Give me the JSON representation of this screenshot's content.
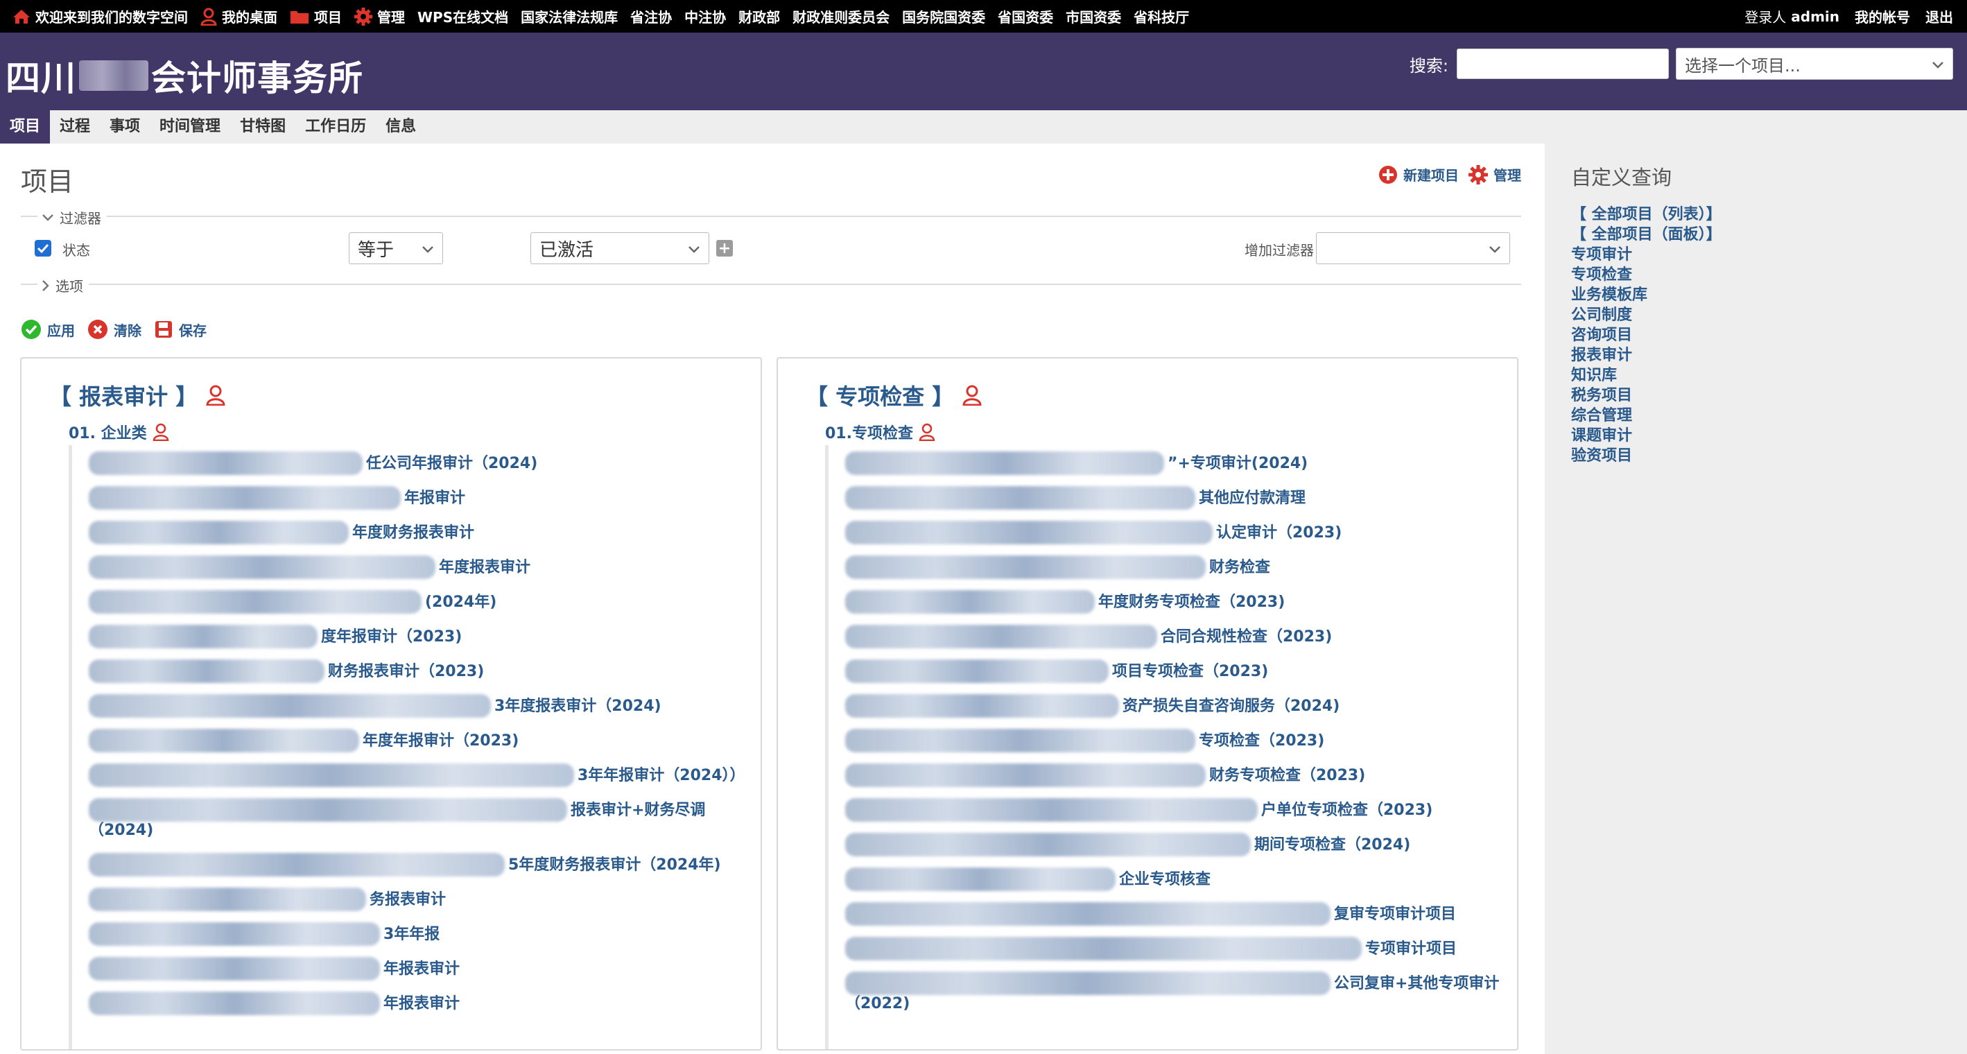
{
  "top_menu": {
    "home": "欢迎来到我们的数字空间",
    "my_page": "我的桌面",
    "projects": "项目",
    "admin": "管理",
    "links": [
      "WPS在线文档",
      "国家法律法规库",
      "省注协",
      "中注协",
      "财政部",
      "财政准则委员会",
      "国务院国资委",
      "省国资委",
      "市国资委",
      "省科技厅"
    ],
    "logged_in_label": "登录人",
    "logged_in_user": "admin",
    "my_account": "我的帐号",
    "logout": "退出"
  },
  "header": {
    "title_prefix": "四川",
    "title_suffix": "会计师事务所",
    "search_label": "搜索:",
    "search_value": "",
    "project_jump": "选择一个项目..."
  },
  "main_menu": [
    "项目",
    "过程",
    "事项",
    "时间管理",
    "甘特图",
    "工作日历",
    "信息"
  ],
  "page": {
    "title": "项目",
    "new_project": "新建项目",
    "manage": "管理"
  },
  "filters": {
    "legend": "过滤器",
    "status_label": "状态",
    "operator": "等于",
    "value": "已激活",
    "add_filter_label": "增加过滤器",
    "add_filter_value": "",
    "options_legend": "选项"
  },
  "buttons": {
    "apply": "应用",
    "clear": "清除",
    "save": "保存"
  },
  "boards": [
    {
      "title": "【 报表审计 】",
      "subtitle": "01. 企业类",
      "items": [
        "任公司年报审计（2024)",
        "年报审计",
        "年度财务报表审计",
        "年度报表审计",
        "(2024年)",
        "度年报审计（2023)",
        "财务报表审计（2023)",
        "3年度报表审计（2024)",
        "年度年报审计（2023)",
        "3年年报审计（2024））",
        "报表审计+财务尽调（2024)",
        "5年度财务报表审计（2024年)",
        "务报表审计",
        "3年年报",
        "年报表审计",
        "年报表审计"
      ]
    },
    {
      "title": "【 专项检查 】",
      "subtitle": "01.专项检查",
      "items": [
        "”+专项审计(2024)",
        "其他应付款清理",
        "认定审计（2023)",
        "财务检查",
        "年度财务专项检查（2023)",
        "合同合规性检查（2023)",
        "项目专项检查（2023)",
        "资产损失自查咨询服务（2024)",
        "专项检查（2023)",
        "财务专项检查（2023)",
        "户单位专项检查（2023)",
        "期间专项检查（2024)",
        "企业专项核查",
        "复审专项审计项目",
        "专项审计项目",
        "公司复审+其他专项审计（2022)"
      ]
    }
  ],
  "sidebar": {
    "title": "自定义查询",
    "links": [
      "【 全部项目（列表）】",
      "【 全部项目（面板）】",
      "专项审计",
      "专项检查",
      "业务模板库",
      "公司制度",
      "咨询项目",
      "报表审计",
      "知识库",
      "税务项目",
      "综合管理",
      "课题审计",
      "验资项目"
    ]
  },
  "colors": {
    "header": "#423867",
    "link": "#2a5a8c",
    "icon_red": "#d9342b",
    "apply_green": "#2eb82e"
  }
}
